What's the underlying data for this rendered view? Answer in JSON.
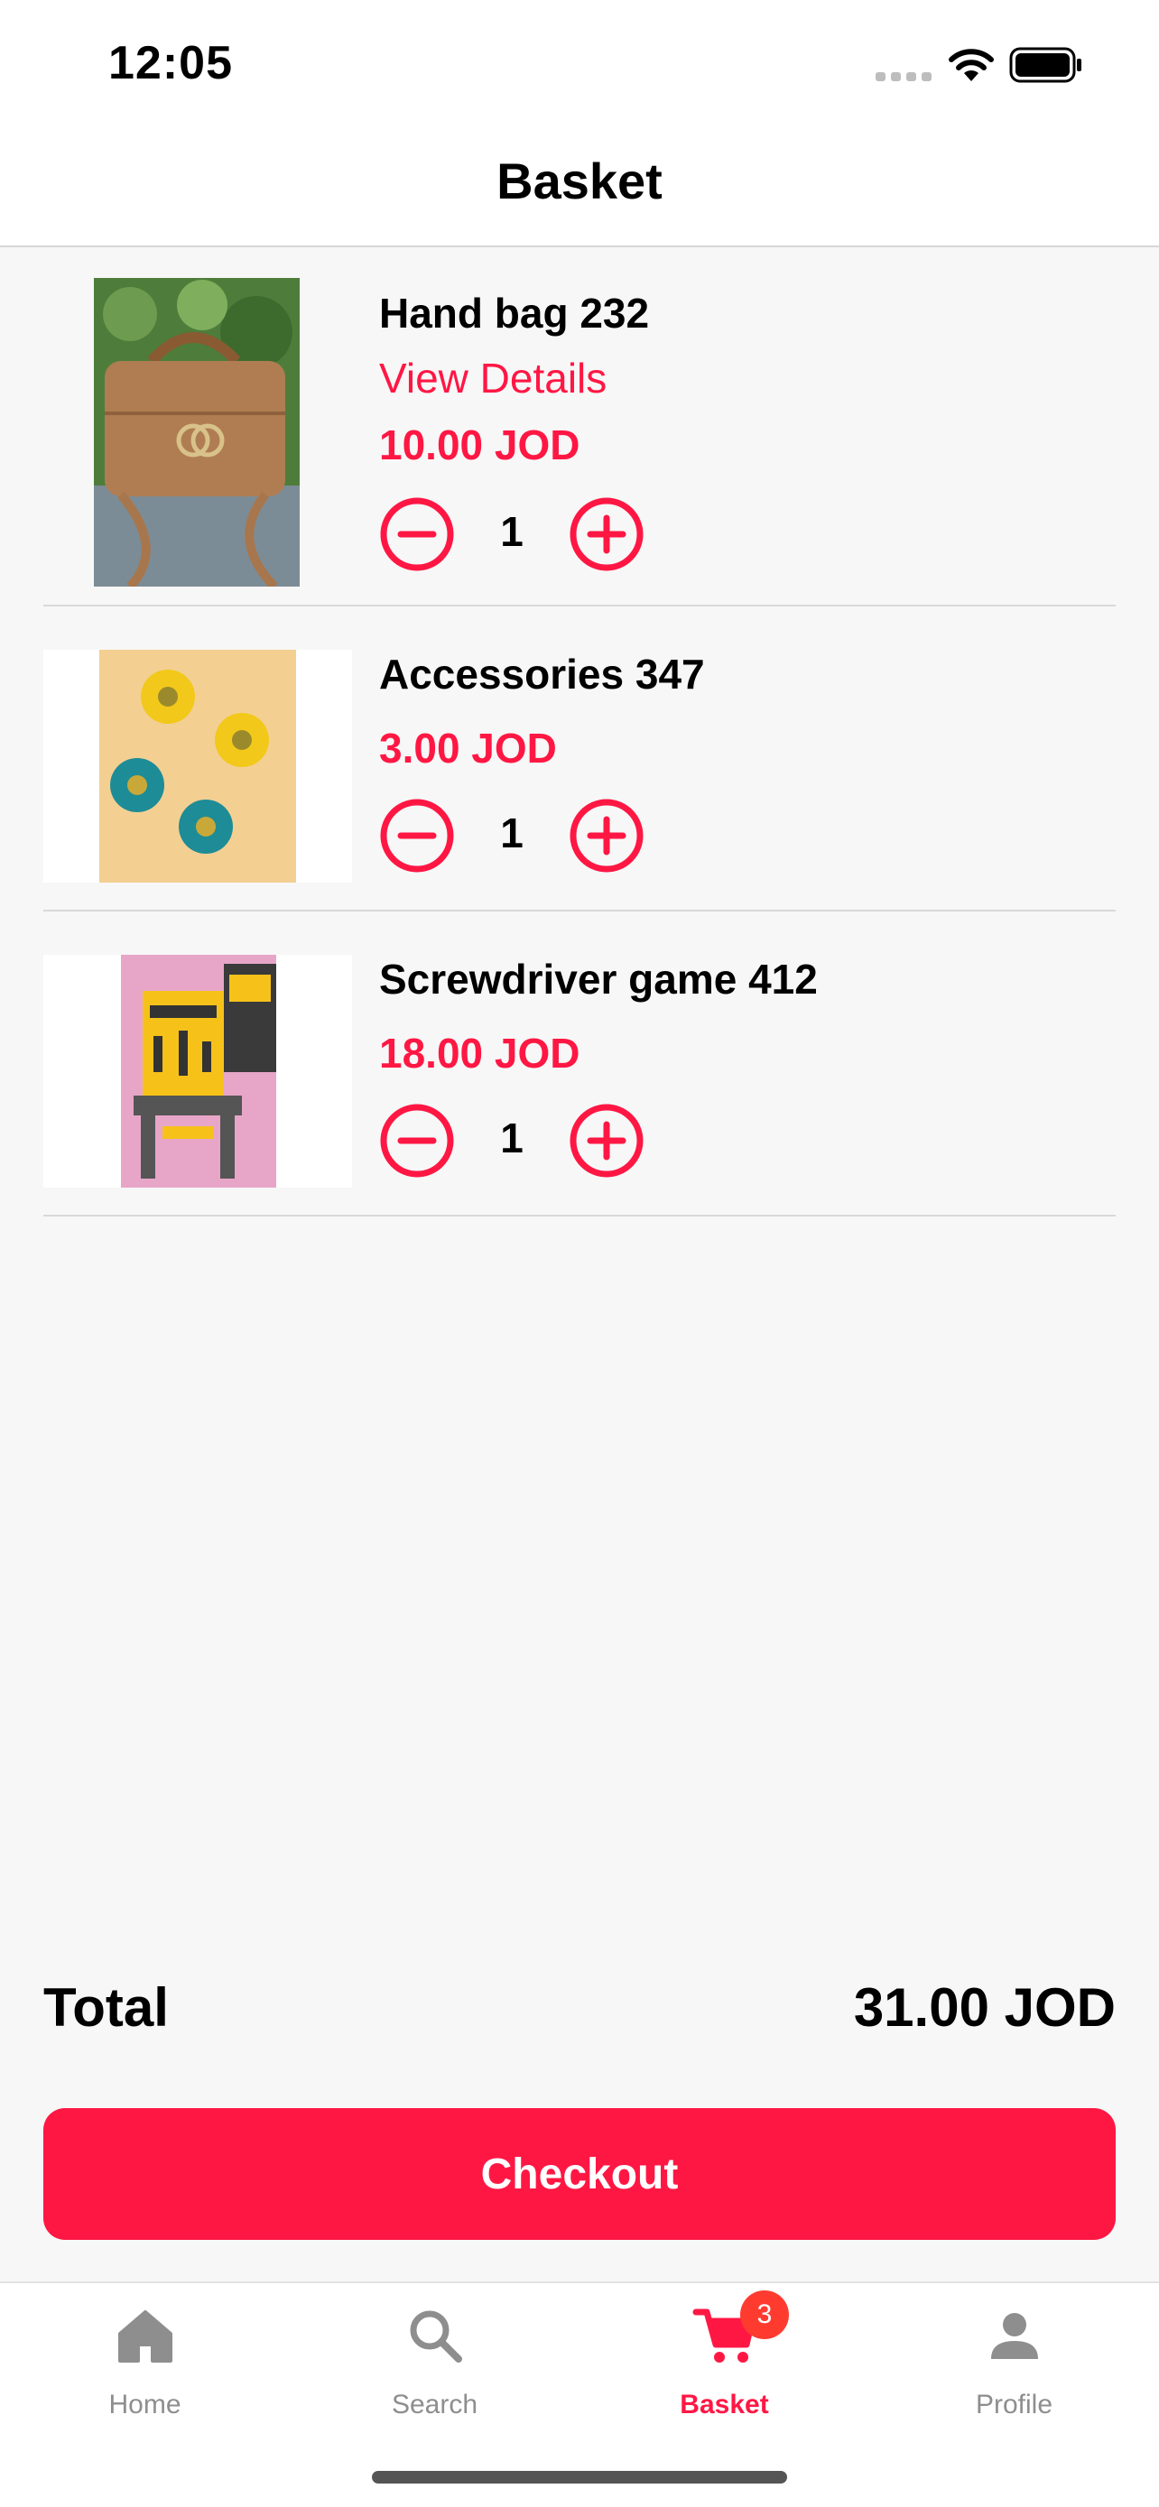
{
  "status_bar": {
    "time": "12:05"
  },
  "header": {
    "title": "Basket"
  },
  "items": [
    {
      "title": "Hand bag 232",
      "link": "View Details",
      "price": "10.00 JOD",
      "quantity": "1"
    },
    {
      "title": "Accessories 347",
      "price": "3.00 JOD",
      "quantity": "1"
    },
    {
      "title": "Screwdriver game 412",
      "price": "18.00 JOD",
      "quantity": "1"
    }
  ],
  "summary": {
    "total_label": "Total",
    "total_value": "31.00 JOD"
  },
  "checkout": {
    "label": "Checkout"
  },
  "tabbar": {
    "tabs": [
      {
        "label": "Home",
        "icon": "home-icon"
      },
      {
        "label": "Search",
        "icon": "search-icon"
      },
      {
        "label": "Basket",
        "icon": "cart-icon",
        "badge": "3",
        "active": true
      },
      {
        "label": "Profile",
        "icon": "person-icon"
      }
    ]
  },
  "colors": {
    "accent": "#ff1744",
    "badge": "#ff3b30",
    "inactive": "#8e8e8e",
    "background": "#f7f7f7"
  }
}
